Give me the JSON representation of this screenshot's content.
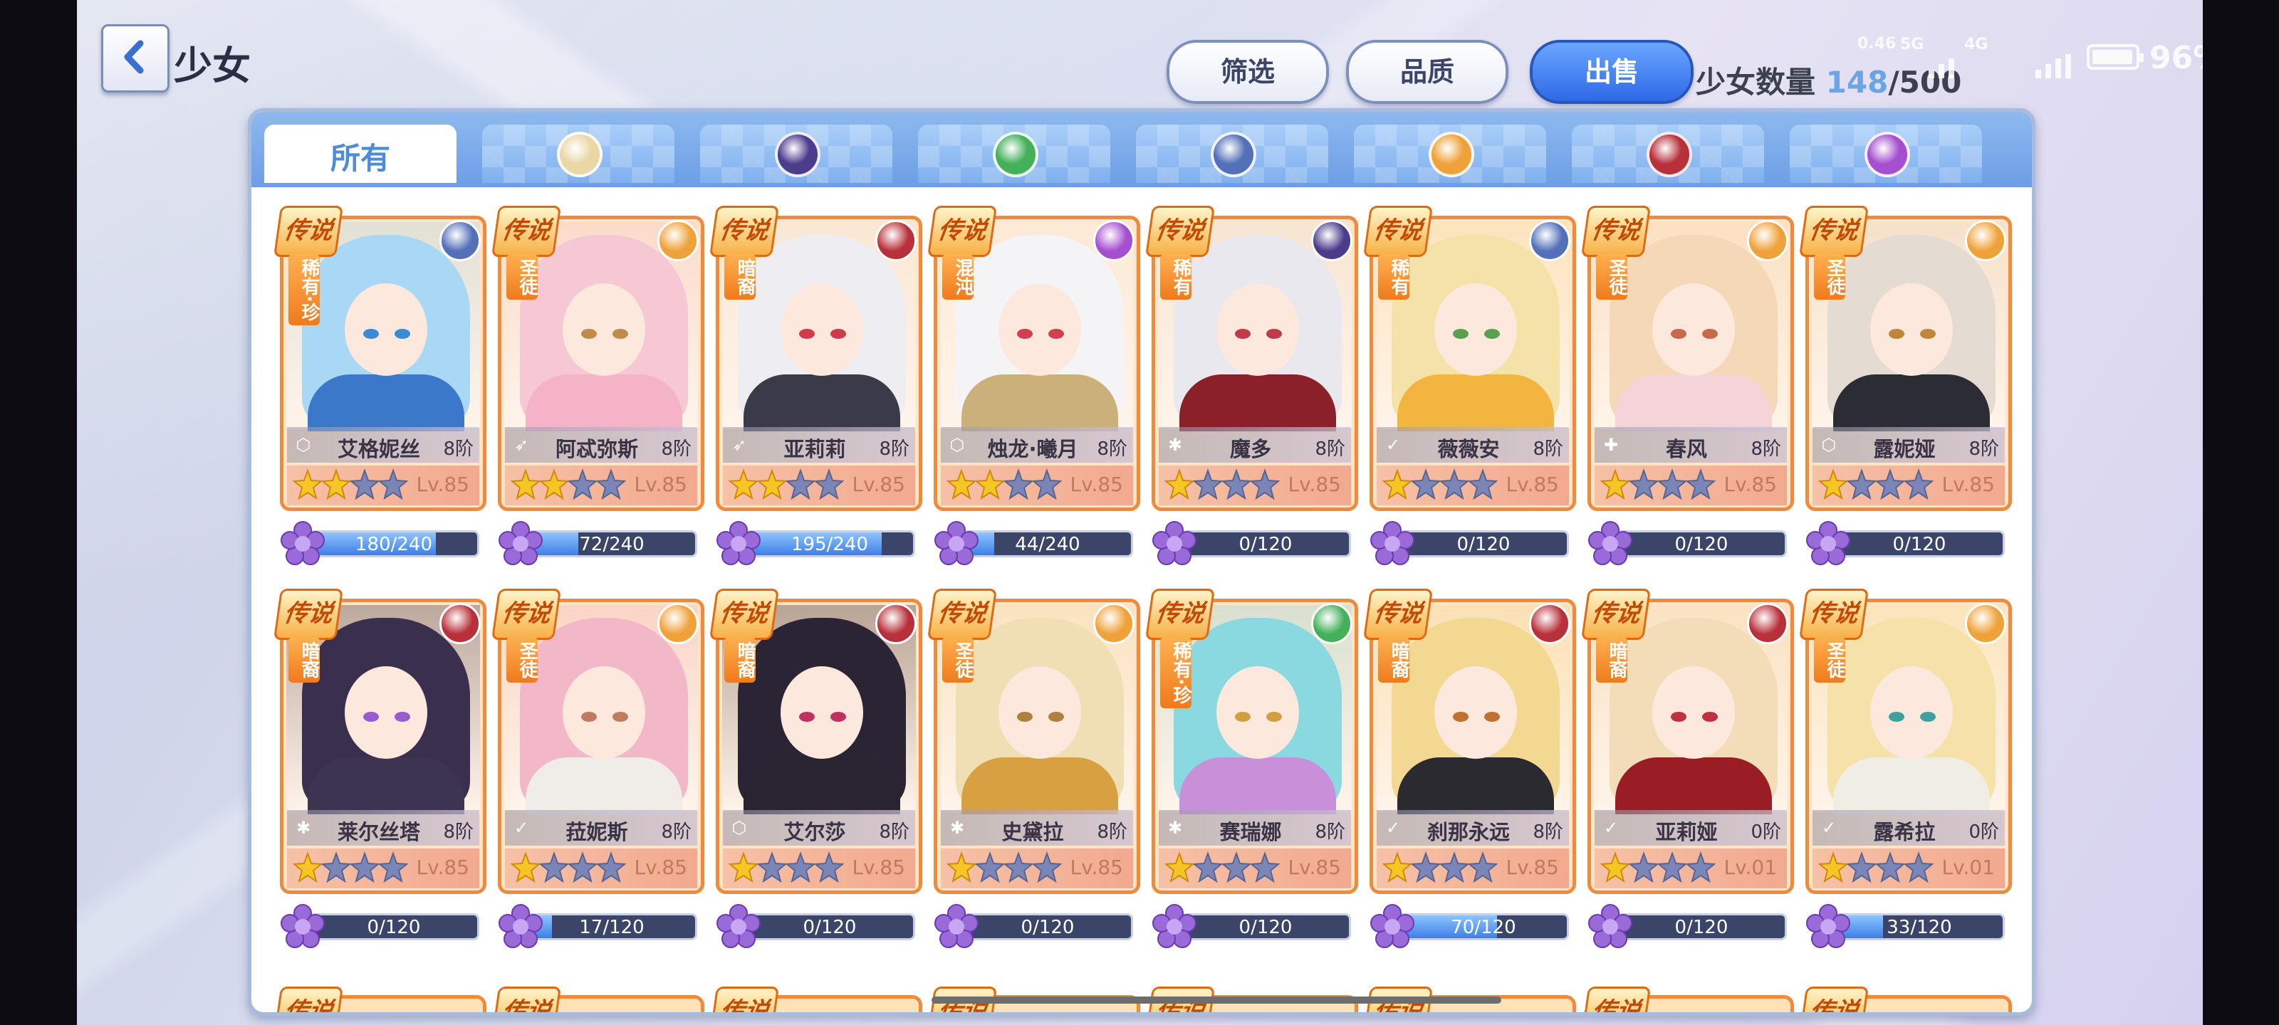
{
  "header": {
    "title": "少女",
    "back_label": "<",
    "filter_label": "筛选",
    "quality_label": "品质",
    "sell_label": "出售",
    "count_label": "少女数量",
    "count_current": "148",
    "count_max": "/500"
  },
  "status_bar": {
    "speed_top": "0.46",
    "speed_unit": "5G",
    "network": "4G",
    "battery": "96%"
  },
  "tabs": [
    {
      "label": "所有",
      "icon": "all",
      "active": true
    },
    {
      "label": "",
      "icon": "sun-emblem-icon",
      "color": "#e9d7a6"
    },
    {
      "label": "",
      "icon": "purple-compass-icon",
      "color": "#4b3c8c"
    },
    {
      "label": "",
      "icon": "green-swirl-icon",
      "color": "#44b05a"
    },
    {
      "label": "",
      "icon": "blue-hexagon-icon",
      "color": "#5370b8"
    },
    {
      "label": "",
      "icon": "golden-sun-icon",
      "color": "#f0a23a"
    },
    {
      "label": "",
      "icon": "red-dragon-icon",
      "color": "#b8303a"
    },
    {
      "label": "",
      "icon": "pink-spiral-icon",
      "color": "#a54fd0"
    }
  ],
  "legend_text": "传说",
  "characters": [
    {
      "name": "艾格妮丝",
      "rank": "8阶",
      "level": "Lv.85",
      "faction": "稀有·珍",
      "stars": 2,
      "progress": "180/240",
      "fill": 0.75,
      "element_color": "#5370b8",
      "hair": "#a9d8f5",
      "body": "#3b78c9",
      "eye": "#3a8ad6",
      "class_icon": "shield"
    },
    {
      "name": "阿忒弥斯",
      "rank": "8阶",
      "level": "Lv.85",
      "faction": "圣徒",
      "stars": 2,
      "progress": "72/240",
      "fill": 0.3,
      "element_color": "#f0a23a",
      "hair": "#f5c8d4",
      "body": "#f5b3c8",
      "eye": "#c08a4a",
      "class_icon": "bow"
    },
    {
      "name": "亚莉莉",
      "rank": "8阶",
      "level": "Lv.85",
      "faction": "暗裔",
      "stars": 2,
      "progress": "195/240",
      "fill": 0.81,
      "element_color": "#b8303a",
      "hair": "#eeeef2",
      "body": "#3a3a48",
      "eye": "#d03a4a",
      "class_icon": "bow"
    },
    {
      "name": "烛龙·曦月",
      "rank": "8阶",
      "level": "Lv.85",
      "faction": "混沌",
      "stars": 2,
      "progress": "44/240",
      "fill": 0.18,
      "element_color": "#a54fd0",
      "hair": "#f4f4f6",
      "body": "#cbb07a",
      "eye": "#d04050",
      "class_icon": "shield"
    },
    {
      "name": "魔多",
      "rank": "8阶",
      "level": "Lv.85",
      "faction": "稀有",
      "stars": 1,
      "progress": "0/120",
      "fill": 0,
      "element_color": "#4b3c8c",
      "hair": "#e8e8ee",
      "body": "#8c2028",
      "eye": "#c03a48",
      "class_icon": "spark"
    },
    {
      "name": "薇薇安",
      "rank": "8阶",
      "level": "Lv.85",
      "faction": "稀有",
      "stars": 1,
      "progress": "0/120",
      "fill": 0,
      "element_color": "#5370b8",
      "hair": "#f5e2a8",
      "body": "#f2b640",
      "eye": "#5aa050",
      "class_icon": "wing"
    },
    {
      "name": "春风",
      "rank": "8阶",
      "level": "Lv.85",
      "faction": "圣徒",
      "stars": 1,
      "progress": "0/120",
      "fill": 0,
      "element_color": "#f0a23a",
      "hair": "#f5d8b8",
      "body": "#f4d4d8",
      "eye": "#c86a4a",
      "class_icon": "cross"
    },
    {
      "name": "露妮娅",
      "rank": "8阶",
      "level": "Lv.85",
      "faction": "圣徒",
      "stars": 1,
      "progress": "0/120",
      "fill": 0,
      "element_color": "#f0a23a",
      "hair": "#e4dcd2",
      "body": "#2c2c34",
      "eye": "#c0863a",
      "class_icon": "shield"
    },
    {
      "name": "莱尔丝塔",
      "rank": "8阶",
      "level": "Lv.85",
      "faction": "暗裔",
      "stars": 1,
      "progress": "0/120",
      "fill": 0,
      "element_color": "#b8303a",
      "hair": "#3a304e",
      "body": "#3c3450",
      "eye": "#9a5ad0",
      "class_icon": "spark"
    },
    {
      "name": "菈妮斯",
      "rank": "8阶",
      "level": "Lv.85",
      "faction": "圣徒",
      "stars": 1,
      "progress": "17/120",
      "fill": 0.14,
      "element_color": "#f0a23a",
      "hair": "#f2b8c8",
      "body": "#f0ede8",
      "eye": "#c07a60",
      "class_icon": "wing"
    },
    {
      "name": "艾尔莎",
      "rank": "8阶",
      "level": "Lv.85",
      "faction": "暗裔",
      "stars": 1,
      "progress": "0/120",
      "fill": 0,
      "element_color": "#b8303a",
      "hair": "#2a2434",
      "body": "#2a2432",
      "eye": "#c03060",
      "class_icon": "shield"
    },
    {
      "name": "史黛拉",
      "rank": "8阶",
      "level": "Lv.85",
      "faction": "圣徒",
      "stars": 1,
      "progress": "0/120",
      "fill": 0,
      "element_color": "#f0a23a",
      "hair": "#f0dfb4",
      "body": "#d8a040",
      "eye": "#b08040",
      "class_icon": "spark"
    },
    {
      "name": "赛瑞娜",
      "rank": "8阶",
      "level": "Lv.85",
      "faction": "稀有·珍",
      "stars": 1,
      "progress": "0/120",
      "fill": 0,
      "element_color": "#44b05a",
      "hair": "#8ad8e0",
      "body": "#c890d8",
      "eye": "#d0a040",
      "class_icon": "spark"
    },
    {
      "name": "刹那永远",
      "rank": "8阶",
      "level": "Lv.85",
      "faction": "暗裔",
      "stars": 1,
      "progress": "70/120",
      "fill": 0.58,
      "element_color": "#b8303a",
      "hair": "#f2d890",
      "body": "#2a2a30",
      "eye": "#c07030",
      "class_icon": "wing"
    },
    {
      "name": "亚莉娅",
      "rank": "0阶",
      "level": "Lv.01",
      "faction": "暗裔",
      "stars": 1,
      "progress": "0/120",
      "fill": 0,
      "element_color": "#b8303a",
      "hair": "#f2ddb8",
      "body": "#9a1c24",
      "eye": "#c03040",
      "class_icon": "wing"
    },
    {
      "name": "露希拉",
      "rank": "0阶",
      "level": "Lv.01",
      "faction": "圣徒",
      "stars": 1,
      "progress": "33/120",
      "fill": 0.28,
      "element_color": "#f0a23a",
      "hair": "#f6e2a8",
      "body": "#f0ede4",
      "eye": "#40a0a0",
      "class_icon": "wing"
    }
  ],
  "colors": {
    "accent_blue": "#4e8cd9",
    "card_border": "#f08a3d",
    "star_gold": "#f6c624",
    "star_empty": "#7a86b8"
  }
}
